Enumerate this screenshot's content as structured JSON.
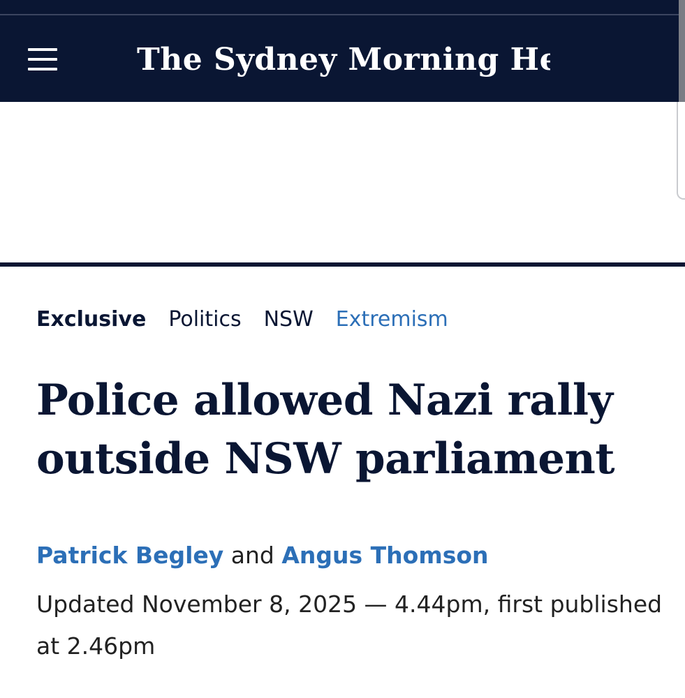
{
  "masthead": {
    "logo_text": "The Sydney Morning Herald",
    "menu_icon": "hamburger-menu-icon",
    "background_color": "#0a1633"
  },
  "article": {
    "tags": {
      "exclusive": "Exclusive",
      "politics": "Politics",
      "nsw": "NSW",
      "extremism": "Extremism"
    },
    "headline": "Police allowed Nazi rally outside NSW parliament",
    "byline": {
      "author_1": "Patrick Begley",
      "connector": "and",
      "author_2": "Angus Thomson"
    },
    "dateline": "Updated November 8, 2025 — 4.44pm, first published at 2.46pm"
  },
  "colors": {
    "link_blue": "#2c6fb7",
    "navy": "#0a1633"
  }
}
